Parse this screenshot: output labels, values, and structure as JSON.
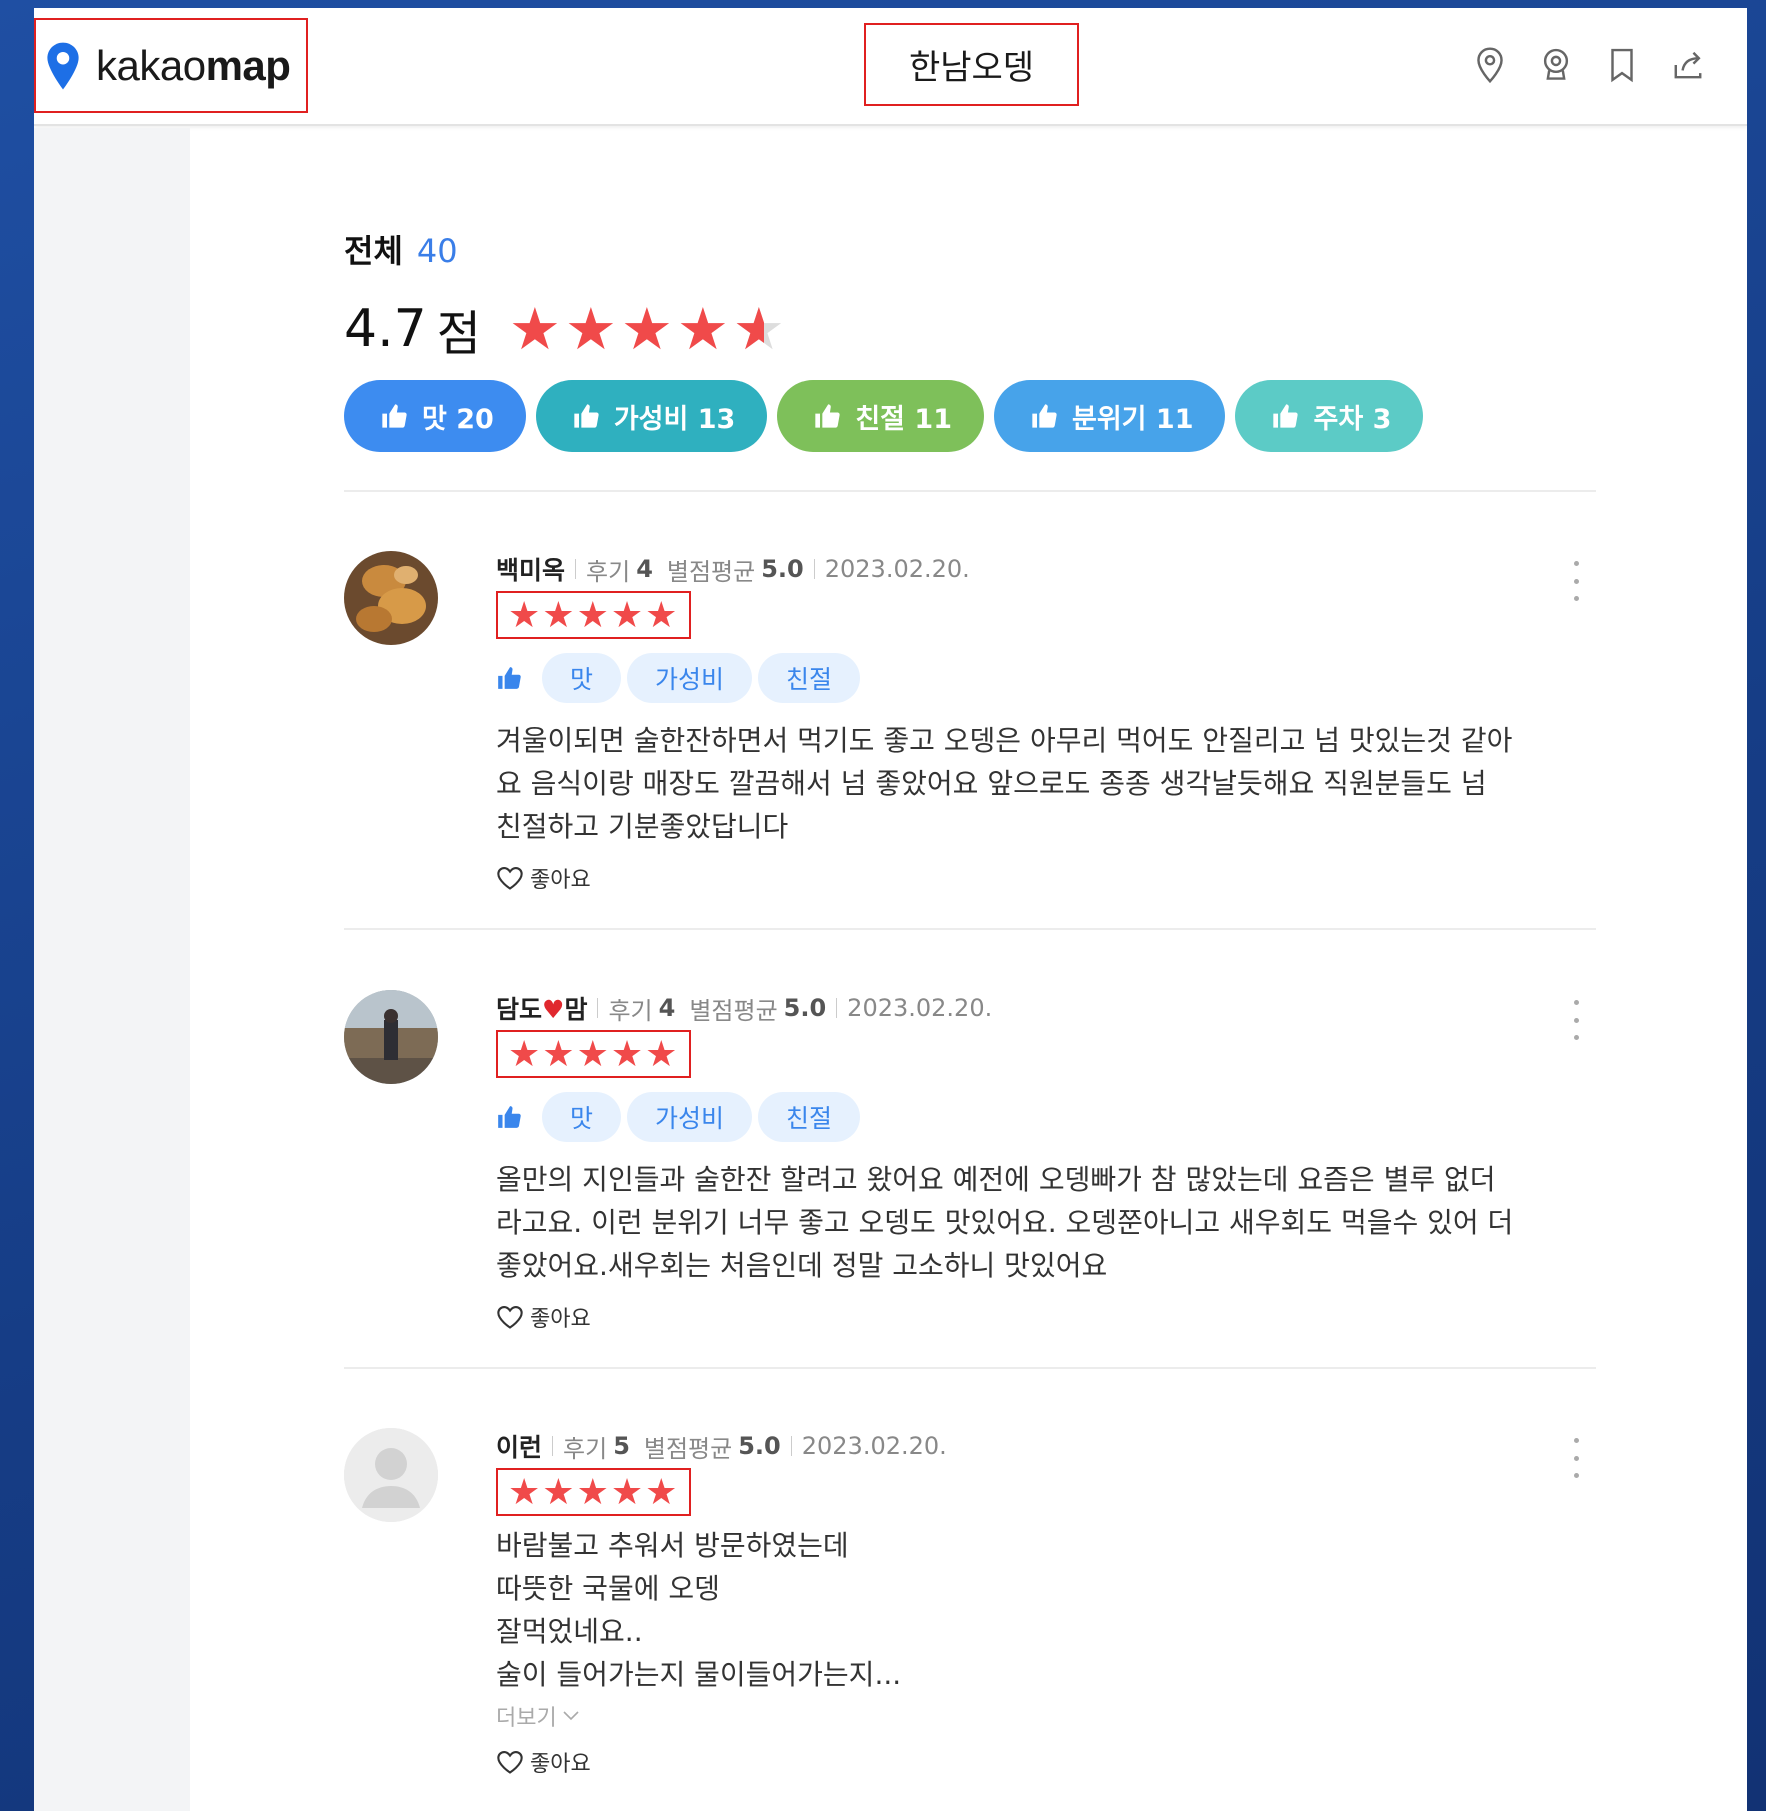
{
  "header": {
    "logo_text_light": "kakao",
    "logo_text_bold": "map",
    "place_title": "한남오뎅",
    "icons": [
      "location-pin-icon",
      "roadview-icon",
      "bookmark-icon",
      "share-icon"
    ]
  },
  "summary": {
    "total_label": "전체",
    "total_count": "40",
    "score": "4.7",
    "score_unit": "점",
    "rating": 4.7
  },
  "chips": [
    {
      "label": "맛 20",
      "color": "#3d8cf0"
    },
    {
      "label": "가성비 13",
      "color": "#2fb0bf"
    },
    {
      "label": "친절 11",
      "color": "#7ec05a"
    },
    {
      "label": "분위기 11",
      "color": "#47a3ea"
    },
    {
      "label": "주차 3",
      "color": "#5ccbc6"
    }
  ],
  "reviews": [
    {
      "author": "백미옥",
      "reviews_label": "후기",
      "reviews_count": "4",
      "avg_label": "별점평균",
      "avg_value": "5.0",
      "date": "2023.02.20.",
      "rating": 5,
      "tags": [
        "맛",
        "가성비",
        "친절"
      ],
      "text": "겨울이되면 술한잔하면서 먹기도 좋고 오뎅은 아무리 먹어도 안질리고 넘 맛있는것 같아\n요 음식이랑 매장도 깔끔해서 넘 좋았어요 앞으로도 종종 생각날듯해요 직원분들도 넘\n친절하고 기분좋았답니다",
      "like_label": "좋아요"
    },
    {
      "author_before": "담도",
      "author_after": "맘",
      "reviews_label": "후기",
      "reviews_count": "4",
      "avg_label": "별점평균",
      "avg_value": "5.0",
      "date": "2023.02.20.",
      "rating": 5,
      "tags": [
        "맛",
        "가성비",
        "친절"
      ],
      "text": "올만의 지인들과 술한잔 할려고 왔어요 예전에 오뎅빠가 참 많았는데 요즘은 별루 없더\n라고요. 이런 분위기 너무 좋고 오뎅도 맛있어요. 오뎅쭌아니고 새우회도 먹을수 있어 더\n좋았어요.새우회는 처음인데 정말 고소하니 맛있어요",
      "like_label": "좋아요"
    },
    {
      "author": "이런",
      "reviews_label": "후기",
      "reviews_count": "5",
      "avg_label": "별점평균",
      "avg_value": "5.0",
      "date": "2023.02.20.",
      "rating": 5,
      "text": "바람불고 추워서 방문하였는데\n따뜻한 국물에 오뎅\n잘먹었네요..\n술이 들어가는지 물이들어가는지...",
      "more_label": "더보기",
      "like_label": "좋아요"
    }
  ]
}
